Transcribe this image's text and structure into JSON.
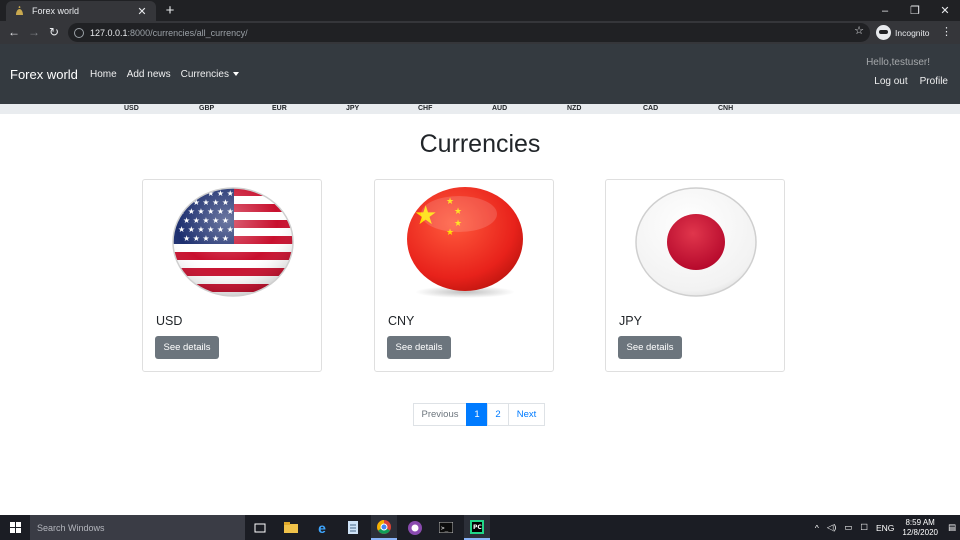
{
  "browser": {
    "tab_title": "Forex world",
    "url_host": "127.0.0.1",
    "url_path": ":8000/currencies/all_currency/",
    "incognito_label": "Incognito"
  },
  "navbar": {
    "brand": "Forex world",
    "links": [
      "Home",
      "Add news",
      "Currencies"
    ],
    "greeting": "Hello,testuser!",
    "logout": "Log out",
    "profile": "Profile"
  },
  "ticker": [
    "USD",
    "GBP",
    "EUR",
    "JPY",
    "CHF",
    "AUD",
    "NZD",
    "CAD",
    "CNH"
  ],
  "main": {
    "title": "Currencies",
    "cards": [
      {
        "code": "USD",
        "button": "See details",
        "flag": "us-flag-icon"
      },
      {
        "code": "CNY",
        "button": "See details",
        "flag": "china-flag-icon"
      },
      {
        "code": "JPY",
        "button": "See details",
        "flag": "japan-flag-icon"
      }
    ]
  },
  "pagination": {
    "previous": "Previous",
    "pages": [
      "1",
      "2"
    ],
    "active": "1",
    "next": "Next"
  },
  "taskbar": {
    "search_placeholder": "Search Windows",
    "language": "ENG",
    "time": "8:59 AM",
    "date": "12/8/2020"
  }
}
